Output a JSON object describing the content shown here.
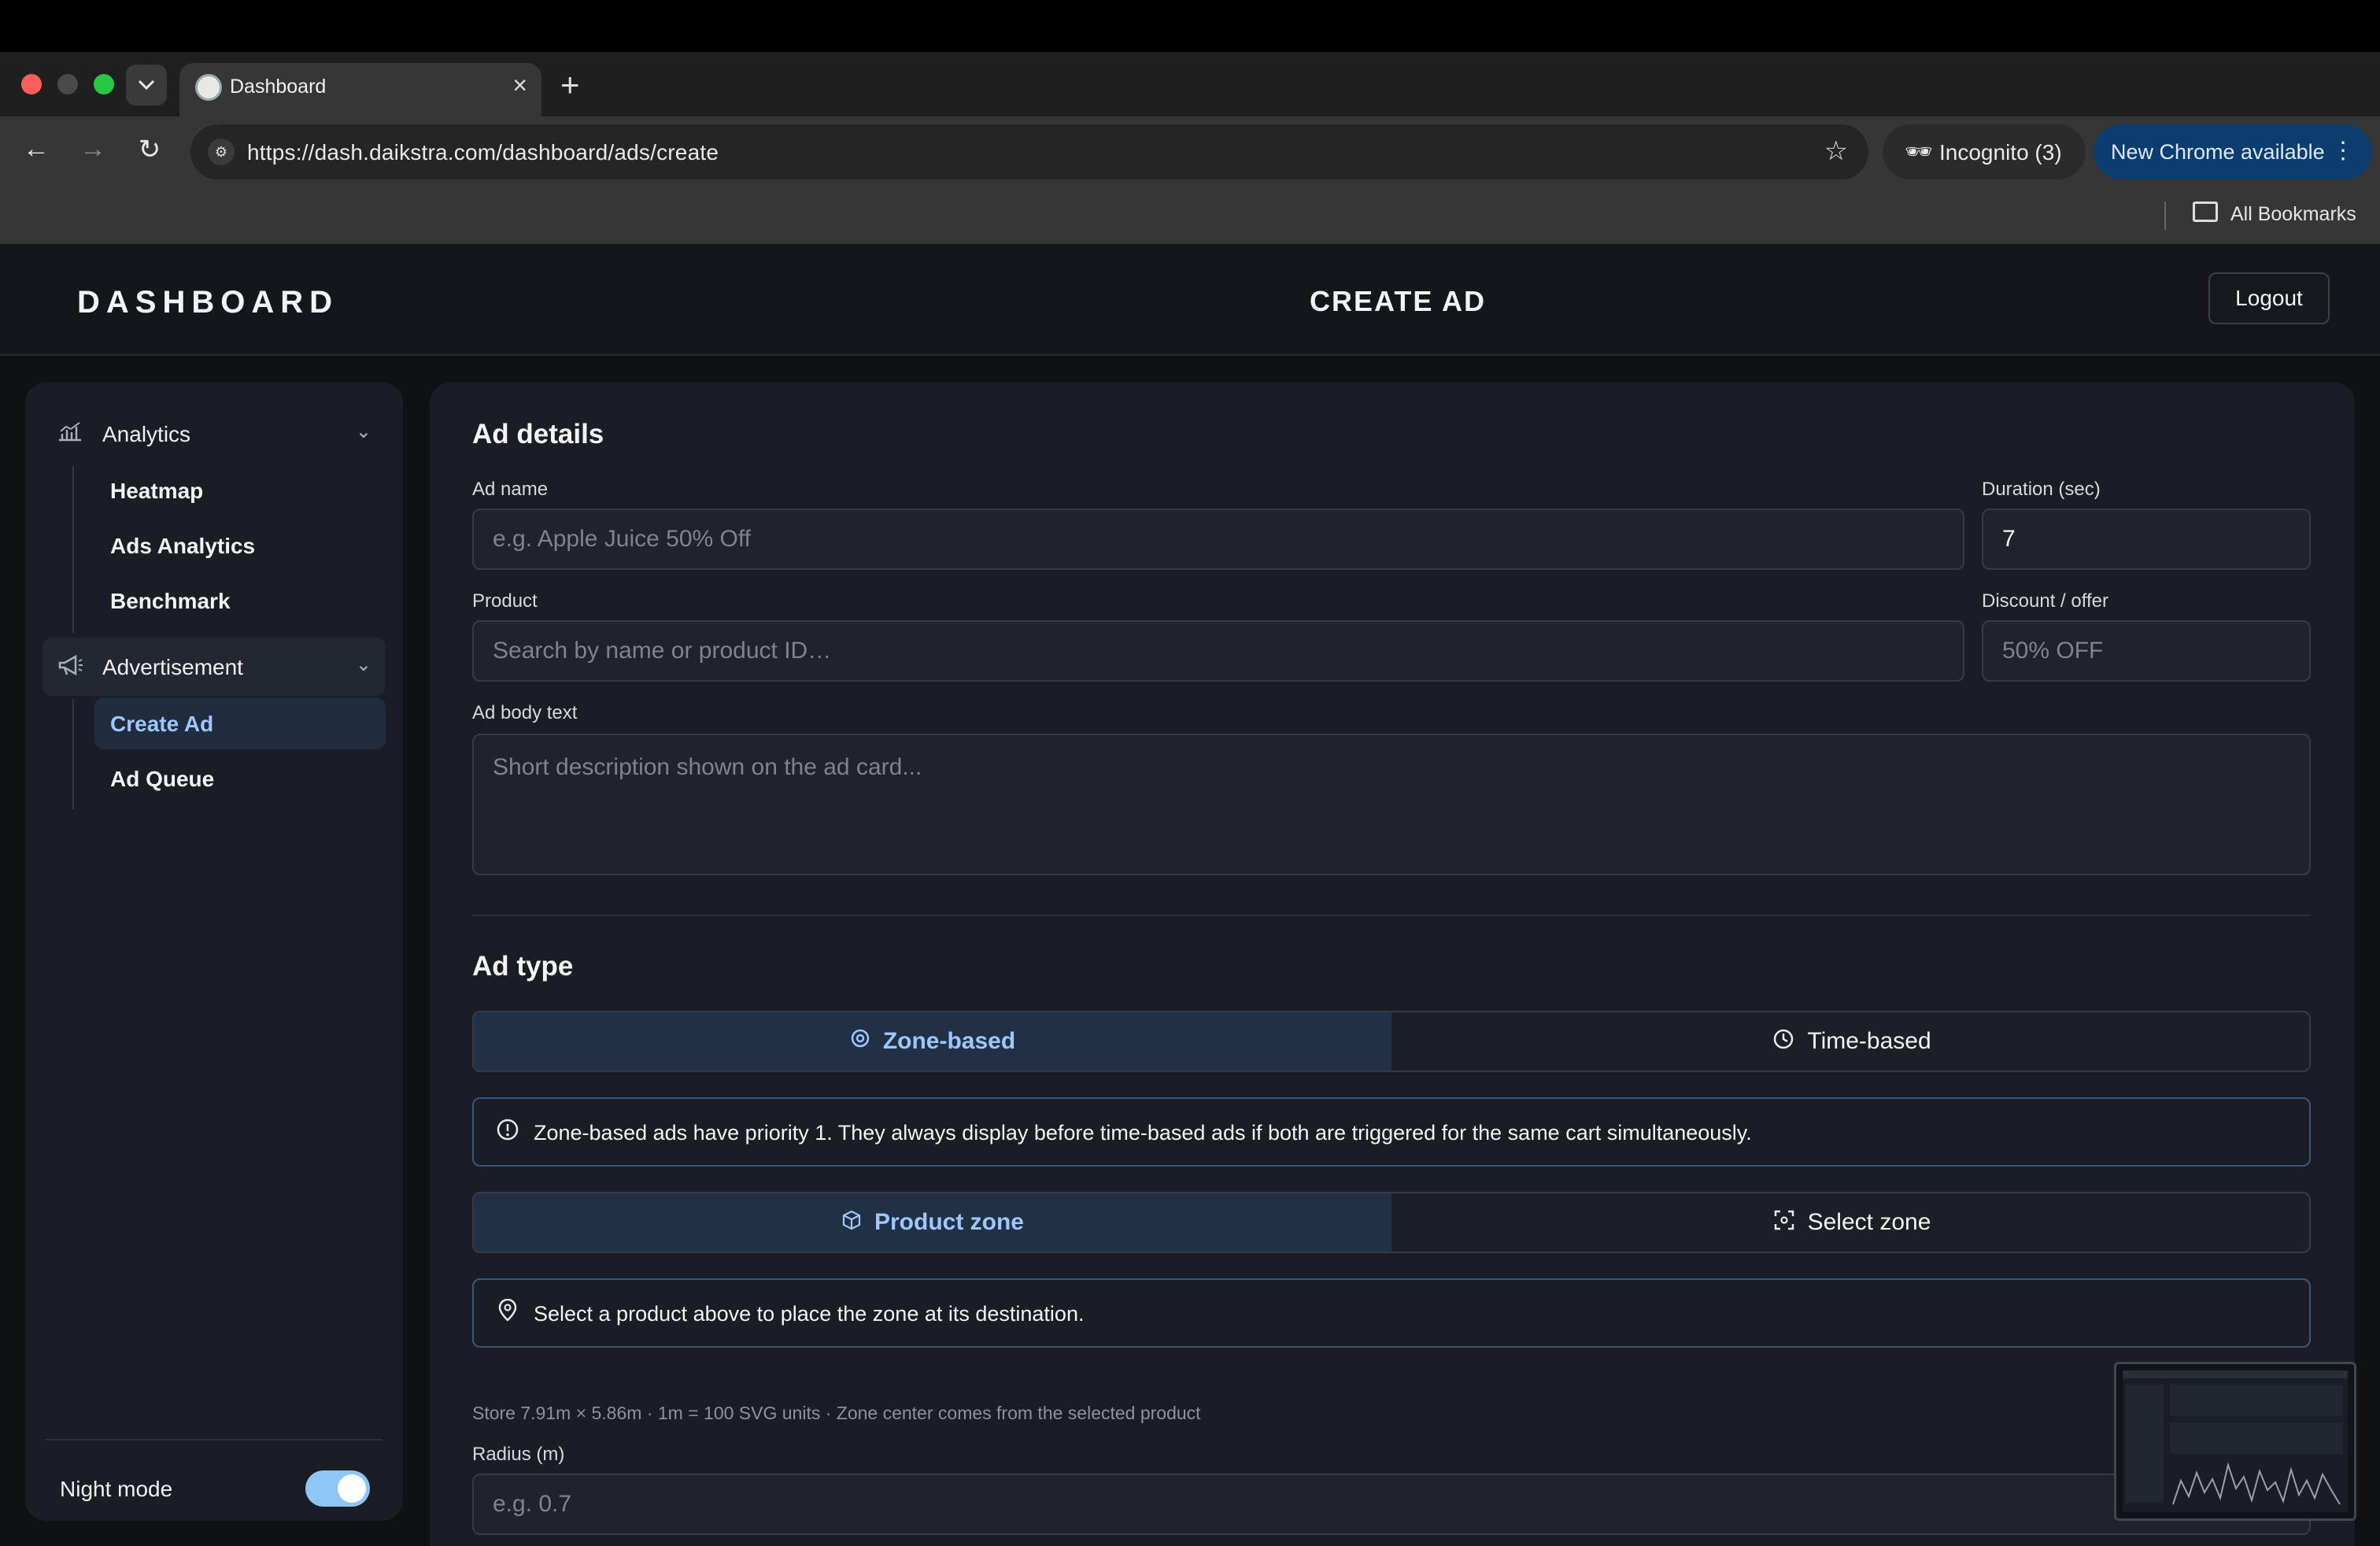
{
  "browser": {
    "tab_title": "Dashboard",
    "url": "https://dash.daikstra.com/dashboard/ads/create",
    "incognito_label": "Incognito (3)",
    "update_label": "New Chrome available",
    "bookmarks_label": "All Bookmarks"
  },
  "header": {
    "brand": "DASHBOARD",
    "title": "CREATE AD",
    "logout_label": "Logout"
  },
  "sidebar": {
    "groups": [
      {
        "label": "Analytics",
        "icon": "bar-chart-icon",
        "items": [
          "Heatmap",
          "Ads Analytics",
          "Benchmark"
        ]
      },
      {
        "label": "Advertisement",
        "icon": "megaphone-icon",
        "items": [
          "Create Ad",
          "Ad Queue"
        ],
        "active_item": "Create Ad"
      }
    ],
    "night_mode_label": "Night mode",
    "night_mode_on": true
  },
  "form": {
    "details_heading": "Ad details",
    "ad_name_label": "Ad name",
    "ad_name_placeholder": "e.g. Apple Juice 50% Off",
    "duration_label": "Duration (sec)",
    "duration_value": "7",
    "product_label": "Product",
    "product_placeholder": "Search by name or product ID…",
    "discount_label": "Discount / offer",
    "discount_placeholder": "50% OFF",
    "body_label": "Ad body text",
    "body_placeholder": "Short description shown on the ad card...",
    "type_heading": "Ad type",
    "type_options": [
      "Zone-based",
      "Time-based"
    ],
    "type_selected": "Zone-based",
    "priority_note": "Zone-based ads have priority 1. They always display before time-based ads if both are triggered for the same cart simultaneously.",
    "zone_options": [
      "Product zone",
      "Select zone"
    ],
    "zone_selected": "Product zone",
    "zone_note": "Select a product above to place the zone at its destination.",
    "store_hint": "Store 7.91m × 5.86m · 1m = 100 SVG units · Zone center comes from the selected product",
    "radius_label": "Radius (m)",
    "radius_placeholder": "e.g. 0.7"
  },
  "colors": {
    "accent": "#9ec7ff",
    "toggle_on": "#8ec5f5",
    "update_pill": "#0b3d6e"
  }
}
